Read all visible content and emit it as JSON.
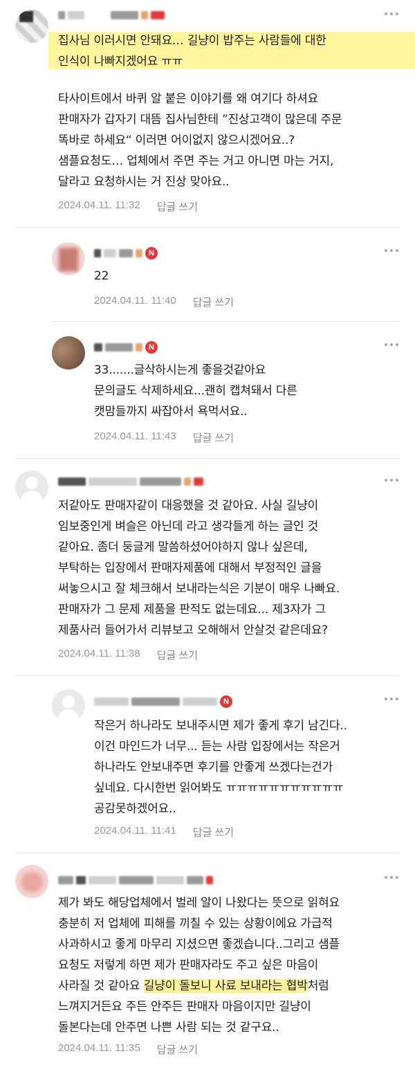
{
  "comments": [
    {
      "text": "",
      "text_hl": "집사님 이러시면 안돼요… 길냥이 밥주는 사람들에 대한\n인식이 나빠지겠어요 ㅠㅠ",
      "text_body": "타사이트에서 바퀴 알 붙은 이야기를 왜 여기다 하셔요\n판매자가 갑자기 대뜸 집사님한테 ”진상고객이 많은데 주문\n똑바로 하세요“ 이러면 어이없지 않으시겠어요..?\n샘플요청도… 업체에서 주면 주는 거고 아니면 마는 거지,\n달라고 요청하시는 거 진상 맞아요..",
      "date": "2024.04.11. 11:32",
      "reply": "답글 쓰기"
    },
    {
      "text": "22",
      "date": "2024.04.11. 11:40",
      "reply": "답글 쓰기"
    },
    {
      "text": "33.......글삭하시는게 좋을것같아요\n문의글도 삭제하세요...괜히 캡쳐돼서 다른\n캣맘들까지 싸잡아서 욕먹서요..",
      "date": "2024.04.11. 11:43",
      "reply": "답글 쓰기"
    },
    {
      "text": "저같아도 판매자같이 대응했을 것 같아요. 사실 길냥이\n임보중인게 벼슬은 아닌데 라고 생각들게 하는 글인 것\n같아요. 좀더 둥글게 말씀하셨어야하지 않나 싶은데,\n부탁하는 입장에서 판매자제품에 대해서 부정적인 글을\n써놓으시고 잘 체크해서 보내라는식은 기분이 매우 나빠요.\n판매자가 그 문제 제품을 판적도 없는데요... 제3자가 그\n제품사러 들어가서 리뷰보고 오해해서 안살것 같은데요?",
      "date": "2024.04.11. 11:38",
      "reply": "답글 쓰기"
    },
    {
      "text": "작은거 하나라도 보내주시면 제가 좋게 후기 남긴다..\n이건 마인드가 너무... 듣는 사람 입장에서는 작은거\n하나라도 안보내주면 후기를 안좋게 쓰겠다는건가\n싶네요. 다시한번 읽어봐도 ㅠㅠㅠㅠㅠㅠㅠㅠㅠㅠㅠ\n공감못하겠어요..",
      "date": "2024.04.11. 11:41",
      "reply": "답글 쓰기"
    },
    {
      "text_a": "제가 봐도 해당업체에서 벌레 알이 나왔다는 뜻으로 읽혀요\n충분히 저 업체에 피해를 끼칠 수 있는 상황이에요 가급적\n사과하시고 좋게 마무리 지셨으면 좋겠습니다..그리고 샘플\n요청도 저렇게 하면 제가 판매자라도 주고 싶은 마음이\n사라질 것 같아요 ",
      "text_hl": "길냥이 돌보니 사료 보내라는 협박",
      "text_b": "처럼\n느껴지거든요 주든 안주든 판매자 마음이지만 길냥이\n돌본다는데 안주면 나쁜 사람 되는 것 같구요..",
      "date": "2024.04.11. 11:35",
      "reply": "답글 쓰기"
    }
  ],
  "badge_letter": "N",
  "colors": {
    "highlight": "#fff59d",
    "badge": "#e53935",
    "meta": "#9a9a9a"
  }
}
